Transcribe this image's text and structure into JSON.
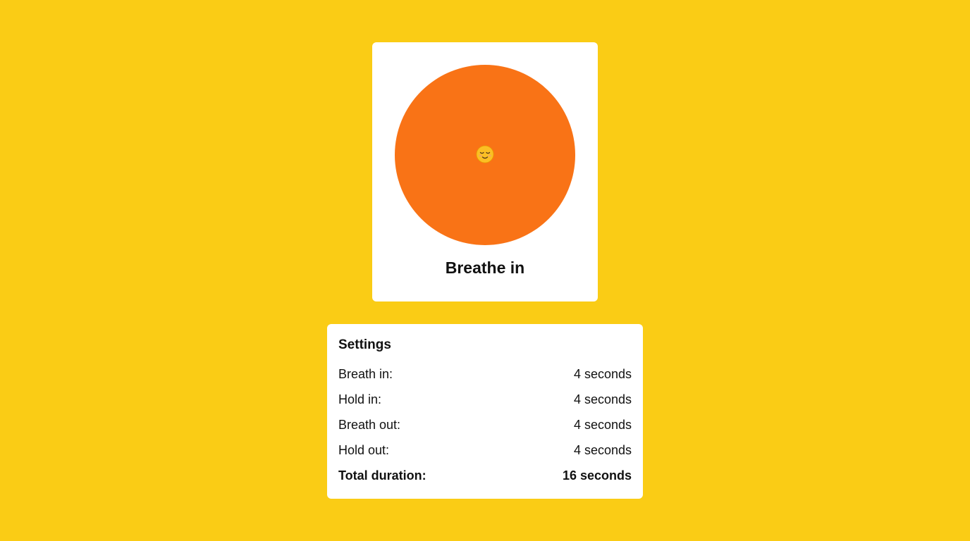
{
  "breath": {
    "face_icon": "relieved-face-icon",
    "phase": "Breathe in",
    "circle_color": "#F97316"
  },
  "settings": {
    "title": "Settings",
    "rows": [
      {
        "label": "Breath in:",
        "value": "4 seconds"
      },
      {
        "label": "Hold in:",
        "value": "4 seconds"
      },
      {
        "label": "Breath out:",
        "value": "4 seconds"
      },
      {
        "label": "Hold out:",
        "value": "4 seconds"
      }
    ],
    "total": {
      "label": "Total duration:",
      "value": "16 seconds"
    }
  },
  "colors": {
    "background": "#FACC15",
    "card": "#FFFFFF",
    "accent": "#F97316"
  }
}
